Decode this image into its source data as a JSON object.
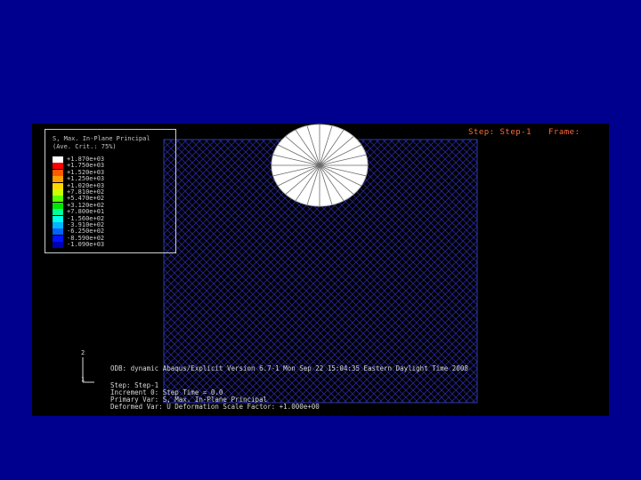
{
  "viewport": {
    "step_label": "Step: Step-1",
    "frame_label": "Frame:"
  },
  "legend": {
    "title_line1": "S, Max. In-Plane Principal",
    "title_line2": "(Ave. Crit.: 75%)",
    "entries": [
      {
        "label": "+1.870e+03",
        "color": "#ffffff"
      },
      {
        "label": "+1.750e+03",
        "color": "#ff0000"
      },
      {
        "label": "+1.520e+03",
        "color": "#ff5a00"
      },
      {
        "label": "+1.250e+03",
        "color": "#ff9f00"
      },
      {
        "label": "+1.020e+03",
        "color": "#ffd800"
      },
      {
        "label": "+7.810e+02",
        "color": "#c8ff00"
      },
      {
        "label": "+5.470e+02",
        "color": "#5aff00"
      },
      {
        "label": "+3.120e+02",
        "color": "#00e600"
      },
      {
        "label": "+7.800e+01",
        "color": "#00ff9a"
      },
      {
        "label": "-1.560e+02",
        "color": "#00ffe6"
      },
      {
        "label": "-3.910e+02",
        "color": "#00b4ff"
      },
      {
        "label": "-6.250e+02",
        "color": "#0064ff"
      },
      {
        "label": "-8.590e+02",
        "color": "#0014ff"
      },
      {
        "label": "-1.090e+03",
        "color": "#0000b4"
      }
    ]
  },
  "triad": {
    "y_label": "2",
    "x_label": "1"
  },
  "info": {
    "line1": "ODB: dynamic  Abaqus/Explicit Version 6.7-1  Mon Sep 22 15:04:35 Eastern Daylight Time 2008",
    "line2": "Step: Step-1",
    "line3": "Increment       0: Step Time = 0.0",
    "line4": "Primary Var: S, Max. In-Plane Principal",
    "line5": "Deformed Var: U   Deformation Scale Factor: +1.000e+00"
  },
  "colors": {
    "page_bg": "#00008f",
    "viewport_bg": "#000000",
    "mesh_line": "#26269a",
    "border": "#2a3aa8",
    "step_text": "#ff6a3a"
  }
}
